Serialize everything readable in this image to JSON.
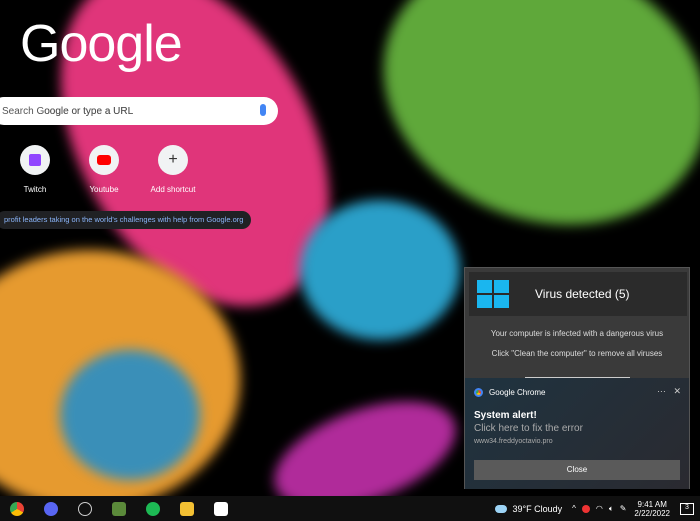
{
  "newtab": {
    "logo": "Google",
    "search_placeholder": "Search Google or type a URL",
    "search_visible": "oogle or type a URL",
    "shortcuts": [
      {
        "label": "Twitch",
        "icon": "twitch-icon"
      },
      {
        "label": "Youtube",
        "icon": "youtube-icon"
      },
      {
        "label": "Add shortcut",
        "icon": "plus-icon"
      }
    ],
    "promo": "profit leaders taking on the world's challenges with help from Google.org"
  },
  "popup": {
    "title": "Virus detected (5)",
    "line1": "Your computer is infected with a dangerous virus",
    "line2": "Click \"Clean the computer\" to remove all viruses"
  },
  "notification": {
    "app": "Google Chrome",
    "more": "···",
    "close_x": "✕",
    "title": "System alert!",
    "body": "Click here to fix the error",
    "source": "www34.freddyoctavio.pro",
    "button": "Close"
  },
  "taskbar": {
    "weather": "39°F  Cloudy",
    "time": "9:41 AM",
    "date": "2/22/2022",
    "notif_count": "3",
    "arrow": "^"
  },
  "colors": {
    "accent": "#1ab6ef"
  }
}
